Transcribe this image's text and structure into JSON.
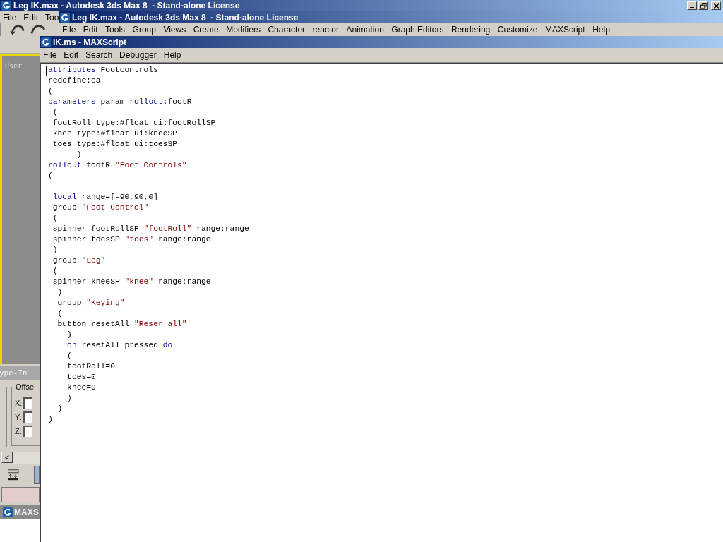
{
  "back_window": {
    "title": "Leg IK.max - Autodesk 3ds Max 8  - Stand-alone License",
    "menu": [
      "File",
      "Edit",
      "Too"
    ],
    "viewport_label": "User",
    "panel_title": "ype-In",
    "group_label": "Offse",
    "axes": [
      "X:",
      "Y:",
      "Z:"
    ],
    "scroll_arrow": "<",
    "taskbar_item": "MAXS"
  },
  "main_window": {
    "title": "Leg IK.max - Autodesk 3ds Max 8  - Stand-alone License",
    "menu": [
      "File",
      "Edit",
      "Tools",
      "Group",
      "Views",
      "Create",
      "Modifiers",
      "Character",
      "reactor",
      "Animation",
      "Graph Editors",
      "Rendering",
      "Customize",
      "MAXScript",
      "Help"
    ]
  },
  "script_window": {
    "title": "IK.ms - MAXScript",
    "menu": [
      "File",
      "Edit",
      "Search",
      "Debugger",
      "Help"
    ],
    "lines": [
      {
        "kind": "code",
        "tokens": [
          {
            "text": "attributes",
            "kind": "keyword"
          },
          {
            "text": " Footcontrols",
            "kind": "plain"
          }
        ]
      },
      {
        "kind": "code",
        "tokens": [
          {
            "text": "redefine:ca",
            "kind": "plain"
          }
        ]
      },
      {
        "kind": "code",
        "tokens": [
          {
            "text": "(",
            "kind": "plain"
          }
        ]
      },
      {
        "kind": "code",
        "tokens": [
          {
            "text": "parameters",
            "kind": "keyword"
          },
          {
            "text": " param ",
            "kind": "plain"
          },
          {
            "text": "rollout",
            "kind": "keyword"
          },
          {
            "text": ":footR",
            "kind": "plain"
          }
        ]
      },
      {
        "kind": "code",
        "tokens": [
          {
            "text": " (",
            "kind": "plain"
          }
        ]
      },
      {
        "kind": "code",
        "tokens": [
          {
            "text": " footRoll type:#float ui:footRollSP",
            "kind": "plain"
          }
        ]
      },
      {
        "kind": "code",
        "tokens": [
          {
            "text": " knee type:#float ui:kneeSP",
            "kind": "plain"
          }
        ]
      },
      {
        "kind": "code",
        "tokens": [
          {
            "text": " toes type:#float ui:toesSP",
            "kind": "plain"
          }
        ]
      },
      {
        "kind": "code",
        "tokens": [
          {
            "text": "      )",
            "kind": "plain"
          }
        ]
      },
      {
        "kind": "code",
        "tokens": [
          {
            "text": "rollout",
            "kind": "keyword"
          },
          {
            "text": " footR ",
            "kind": "plain"
          },
          {
            "text": "\"Foot Controls\"",
            "kind": "string"
          }
        ]
      },
      {
        "kind": "code",
        "tokens": [
          {
            "text": "(",
            "kind": "plain"
          }
        ]
      },
      {
        "kind": "blank"
      },
      {
        "kind": "code",
        "tokens": [
          {
            "text": " local",
            "kind": "keyword"
          },
          {
            "text": " range=[-90,90,0]",
            "kind": "plain"
          }
        ]
      },
      {
        "kind": "code",
        "tokens": [
          {
            "text": " group ",
            "kind": "plain"
          },
          {
            "text": "\"Foot Control\"",
            "kind": "string"
          }
        ]
      },
      {
        "kind": "code",
        "tokens": [
          {
            "text": " (",
            "kind": "plain"
          }
        ]
      },
      {
        "kind": "code",
        "tokens": [
          {
            "text": " spinner footRollSP ",
            "kind": "plain"
          },
          {
            "text": "\"footRoll\"",
            "kind": "string"
          },
          {
            "text": " range:range",
            "kind": "plain"
          }
        ]
      },
      {
        "kind": "code",
        "tokens": [
          {
            "text": " spinner toesSP ",
            "kind": "plain"
          },
          {
            "text": "\"toes\"",
            "kind": "string"
          },
          {
            "text": " range:range",
            "kind": "plain"
          }
        ]
      },
      {
        "kind": "code",
        "tokens": [
          {
            "text": " )",
            "kind": "plain"
          }
        ]
      },
      {
        "kind": "code",
        "tokens": [
          {
            "text": " group ",
            "kind": "plain"
          },
          {
            "text": "\"Leg\"",
            "kind": "string"
          }
        ]
      },
      {
        "kind": "code",
        "tokens": [
          {
            "text": " (",
            "kind": "plain"
          }
        ]
      },
      {
        "kind": "code",
        "tokens": [
          {
            "text": " spinner kneeSP ",
            "kind": "plain"
          },
          {
            "text": "\"knee\"",
            "kind": "string"
          },
          {
            "text": " range:range",
            "kind": "plain"
          }
        ]
      },
      {
        "kind": "code",
        "tokens": [
          {
            "text": "  )",
            "kind": "plain"
          }
        ]
      },
      {
        "kind": "code",
        "tokens": [
          {
            "text": "  group ",
            "kind": "plain"
          },
          {
            "text": "\"Keying\"",
            "kind": "string"
          }
        ]
      },
      {
        "kind": "code",
        "tokens": [
          {
            "text": "  (",
            "kind": "plain"
          }
        ]
      },
      {
        "kind": "code",
        "tokens": [
          {
            "text": "  button resetAll ",
            "kind": "plain"
          },
          {
            "text": "\"Reser all\"",
            "kind": "string"
          }
        ]
      },
      {
        "kind": "code",
        "tokens": [
          {
            "text": "    )",
            "kind": "plain"
          }
        ]
      },
      {
        "kind": "code",
        "tokens": [
          {
            "text": "    on",
            "kind": "keyword"
          },
          {
            "text": " resetAll pressed ",
            "kind": "plain"
          },
          {
            "text": "do",
            "kind": "keyword"
          }
        ]
      },
      {
        "kind": "code",
        "tokens": [
          {
            "text": "    (",
            "kind": "plain"
          }
        ]
      },
      {
        "kind": "code",
        "tokens": [
          {
            "text": "    footRoll=0",
            "kind": "plain"
          }
        ]
      },
      {
        "kind": "code",
        "tokens": [
          {
            "text": "    toes=0",
            "kind": "plain"
          }
        ]
      },
      {
        "kind": "code",
        "tokens": [
          {
            "text": "    knee=0",
            "kind": "plain"
          }
        ]
      },
      {
        "kind": "code",
        "tokens": [
          {
            "text": "    )",
            "kind": "plain"
          }
        ]
      },
      {
        "kind": "code",
        "tokens": [
          {
            "text": "  )",
            "kind": "plain"
          }
        ]
      },
      {
        "kind": "code",
        "tokens": [
          {
            "text": ")",
            "kind": "plain"
          }
        ]
      }
    ]
  }
}
